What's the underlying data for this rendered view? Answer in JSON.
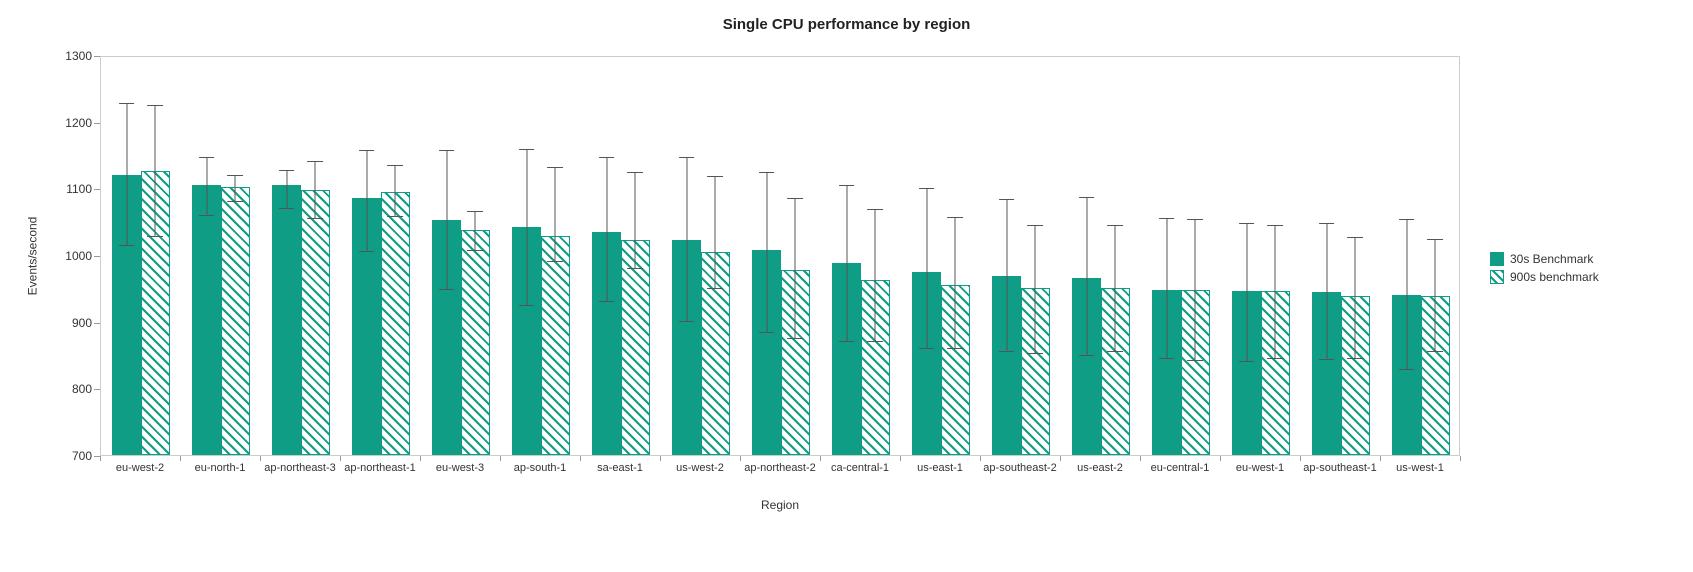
{
  "chart_data": {
    "type": "bar",
    "title": "Single CPU performance by region",
    "xlabel": "Region",
    "ylabel": "Events/second",
    "ylim": [
      700,
      1300
    ],
    "yticks": [
      700,
      800,
      900,
      1000,
      1100,
      1200,
      1300
    ],
    "categories": [
      "eu-west-2",
      "eu-north-1",
      "ap-northeast-3",
      "ap-northeast-1",
      "eu-west-3",
      "ap-south-1",
      "sa-east-1",
      "us-west-2",
      "ap-northeast-2",
      "ca-central-1",
      "us-east-1",
      "ap-southeast-2",
      "us-east-2",
      "eu-central-1",
      "eu-west-1",
      "ap-southeast-1",
      "us-west-1"
    ],
    "series": [
      {
        "name": "30s Benchmark",
        "values": [
          1120,
          1105,
          1105,
          1085,
          1053,
          1042,
          1035,
          1022,
          1008,
          988,
          975,
          968,
          965,
          948,
          946,
          945,
          940
        ],
        "err_low": [
          1015,
          1060,
          1070,
          1005,
          948,
          925,
          930,
          900,
          884,
          870,
          860,
          855,
          850,
          845,
          841,
          843,
          828
        ],
        "err_high": [
          1228,
          1147,
          1127,
          1157,
          1157,
          1158,
          1147,
          1147,
          1124,
          1105,
          1100,
          1083,
          1086,
          1055,
          1048,
          1047,
          1054
        ]
      },
      {
        "name": "900s benchmark",
        "values": [
          1126,
          1102,
          1097,
          1094,
          1037,
          1028,
          1023,
          1004,
          978,
          963,
          955,
          950,
          950,
          948,
          946,
          938,
          938
        ],
        "err_low": [
          1028,
          1081,
          1055,
          1058,
          1007,
          990,
          980,
          950,
          875,
          870,
          860,
          853,
          855,
          842,
          845,
          845,
          855
        ],
        "err_high": [
          1225,
          1120,
          1141,
          1135,
          1065,
          1132,
          1124,
          1118,
          1085,
          1068,
          1057,
          1045,
          1045,
          1053,
          1044,
          1027,
          1024
        ]
      }
    ],
    "colors": {
      "primary": "#0f9d85"
    },
    "legend_position": "right"
  }
}
